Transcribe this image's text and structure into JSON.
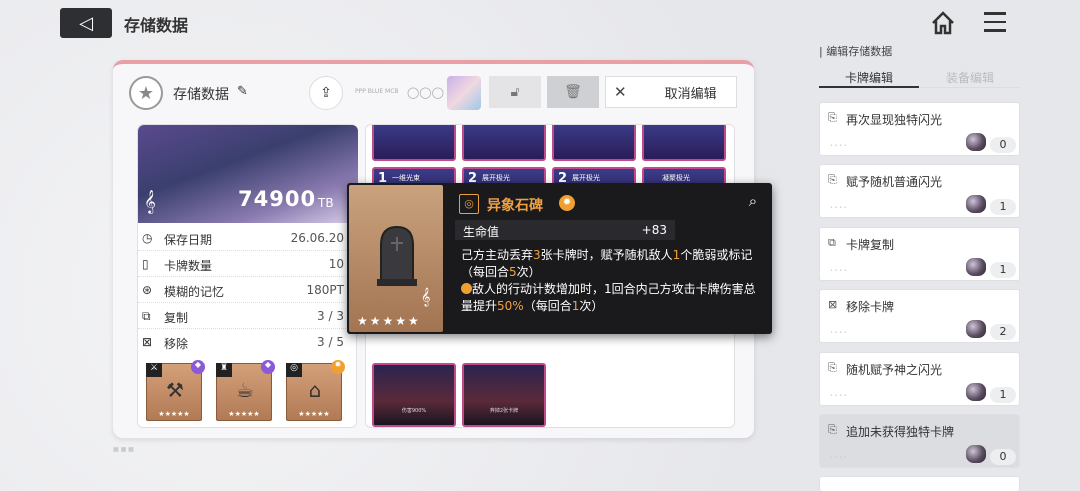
{
  "header": {
    "title": "存储数据"
  },
  "panel": {
    "title": "存储数据",
    "small_text": "PPP BLUE MCB",
    "cancel_label": "取消编辑"
  },
  "left_card": {
    "score": "74900",
    "unit": "TB",
    "stats": [
      {
        "icon": "clock-icon",
        "label": "保存日期",
        "value": "26.06.20"
      },
      {
        "icon": "card-icon",
        "label": "卡牌数量",
        "value": "10"
      },
      {
        "icon": "memory-icon",
        "label": "模糊的记忆",
        "value": "180PT"
      },
      {
        "icon": "copy-icon",
        "label": "复制",
        "value": "3 / 3"
      },
      {
        "icon": "remove-icon",
        "label": "移除",
        "value": "3 / 5"
      }
    ],
    "relics": [
      {
        "name": "relic-claw",
        "stars": "★★★★★"
      },
      {
        "name": "relic-teacup",
        "stars": "★★★★★"
      },
      {
        "name": "relic-tombstone",
        "stars": "★★★★★"
      }
    ]
  },
  "grid_cards": [
    {
      "num": "",
      "name": ""
    },
    {
      "num": "",
      "name": ""
    },
    {
      "num": "",
      "name": ""
    },
    {
      "num": "",
      "name": ""
    },
    {
      "num": "1",
      "name": "一维光束"
    },
    {
      "num": "2",
      "name": "展开极光"
    },
    {
      "num": "2",
      "name": "展开极光"
    },
    {
      "num": "",
      "name": "凝聚极光"
    }
  ],
  "tall_cards": [
    {
      "text": "伤害900%"
    },
    {
      "text": "弃掉2张卡牌"
    }
  ],
  "tooltip": {
    "name": "异象石碑",
    "stat_label": "生命值",
    "stat_value": "+83",
    "stars": "★★★★★",
    "desc1_a": "己方主动丢弃",
    "desc1_n1": "3",
    "desc1_b": "张卡牌时，赋予随机敌人",
    "desc1_n2": "1",
    "desc1_c": "个脆弱或标记（每回合",
    "desc1_n3": "5",
    "desc1_d": "次）",
    "desc2_a": "敌人的行动计数增加时，1回合内己方攻击卡牌伤害总量提升",
    "desc2_n1": "50%",
    "desc2_b": "（每回合",
    "desc2_n2": "1",
    "desc2_c": "次）"
  },
  "sidebar": {
    "subtitle": "编辑存储数据",
    "tab_active": "卡牌编辑",
    "tab_inactive": "装备编辑",
    "items": [
      {
        "label": "再次显现独特闪光",
        "count": "0"
      },
      {
        "label": "赋予随机普通闪光",
        "count": "1"
      },
      {
        "label": "卡牌复制",
        "count": "1"
      },
      {
        "label": "移除卡牌",
        "count": "2"
      },
      {
        "label": "随机赋予神之闪光",
        "count": "1"
      },
      {
        "label": "追加未获得独特卡牌",
        "count": "0"
      }
    ]
  }
}
